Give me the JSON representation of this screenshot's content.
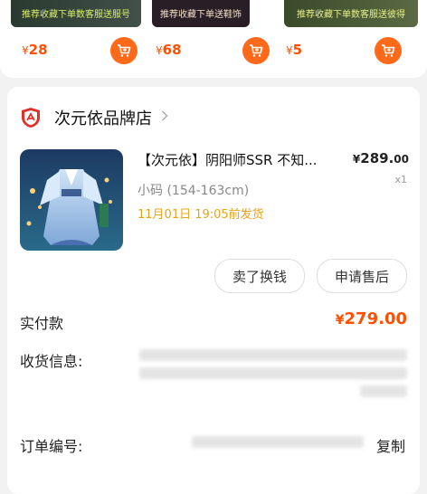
{
  "recommendations": [
    {
      "banner": "推荐收藏下单数客服送服号",
      "price_symbol": "¥",
      "price": "28"
    },
    {
      "banner": "推荐收藏下单送鞋饰",
      "price_symbol": "¥",
      "price": "68"
    },
    {
      "banner": "推荐收藏下单数客服送彼得",
      "price_symbol": "¥",
      "price": "5"
    }
  ],
  "order": {
    "shop_name": "次元依品牌店",
    "item_title": "【次元依】阴阳师SSR 不知...",
    "price_symbol": "¥",
    "price_main": "289.",
    "price_cents": "00",
    "quantity": "x1",
    "sku": "小码 (154-163cm)",
    "shipping": "11月01日 19:05前发货",
    "buttons": {
      "sell": "卖了换钱",
      "after_sale": "申请售后"
    },
    "paid_label": "实付款",
    "paid_symbol": "¥",
    "paid_amount": "279.00",
    "address_label": "收货信息:",
    "order_no_label": "订单编号:",
    "copy_label": "复制"
  },
  "colors": {
    "accent": "#ff5000",
    "cart": "#ff6a1a",
    "ship": "#e8a31a"
  }
}
